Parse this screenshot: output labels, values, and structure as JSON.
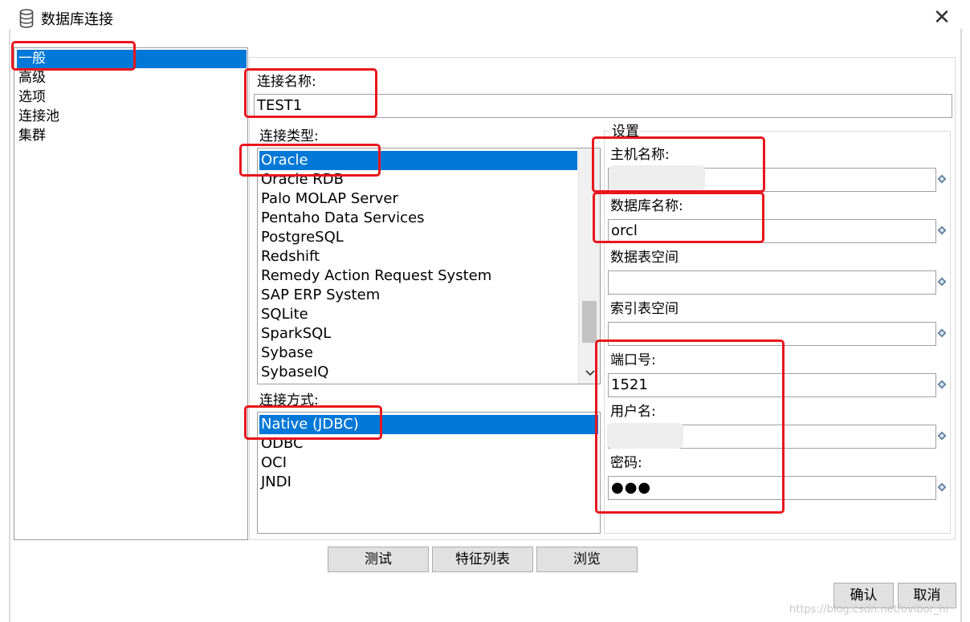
{
  "window": {
    "title": "数据库连接",
    "close_symbol": "✕"
  },
  "nav": {
    "items": [
      "一般",
      "高级",
      "选项",
      "连接池",
      "集群"
    ],
    "selected_index": 0
  },
  "connection_name": {
    "label": "连接名称:",
    "value": "TEST1"
  },
  "connection_type": {
    "label": "连接类型:",
    "items": [
      "Oracle",
      "Oracle RDB",
      "Palo MOLAP Server",
      "Pentaho Data Services",
      "PostgreSQL",
      "Redshift",
      "Remedy Action Request System",
      "SAP ERP System",
      "SQLite",
      "SparkSQL",
      "Sybase",
      "SybaseIQ"
    ],
    "selected_index": 0
  },
  "access_method": {
    "label": "连接方式:",
    "items": [
      "Native (JDBC)",
      "ODBC",
      "OCI",
      "JNDI"
    ],
    "selected_index": 0
  },
  "settings": {
    "group_label": "设置",
    "host_label": "主机名称:",
    "host_value": "",
    "db_label": "数据库名称:",
    "db_value": "orcl",
    "tablespace_data_label": "数据表空间",
    "tablespace_data_value": "",
    "tablespace_index_label": "索引表空间",
    "tablespace_index_value": "",
    "port_label": "端口号:",
    "port_value": "1521",
    "user_label": "用户名:",
    "user_value": "",
    "password_label": "密码:",
    "password_value": "●●●"
  },
  "buttons": {
    "test": "测试",
    "features": "特征列表",
    "explore": "浏览",
    "ok": "确认",
    "cancel": "取消"
  },
  "watermark": "https://blog.csdn.net/ovibor_ni",
  "colors": {
    "selection": "#0078d7",
    "annotation_red": "#e8161c"
  },
  "icons": {
    "title": "database-icon",
    "variable": "variable-diamond-icon",
    "scroll_down": "chevron-down-icon"
  }
}
